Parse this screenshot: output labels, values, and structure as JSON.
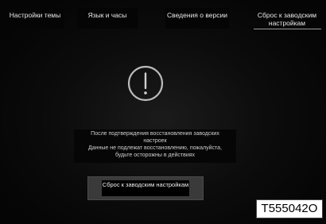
{
  "tabs": [
    {
      "label": "Настройки темы"
    },
    {
      "label": "Язык и часы"
    },
    {
      "label": "Сведения о версии"
    },
    {
      "label": "Сброс к заводским настройкам",
      "selected": true
    }
  ],
  "warning_icon": "exclamation-circle-icon",
  "message": {
    "line1": "После подтверждения восстановления заводских",
    "line2": "настроек",
    "line3": "Данные не подлежат восстановлению, пожалуйста,",
    "line4": "будьте осторожны в действиях"
  },
  "reset_button": {
    "label": "Сброс к заводским настройкам"
  },
  "image_code": "T555042O",
  "colors": {
    "accent_underline": "#9a9a9a",
    "button_bg": "#3a3a3a"
  }
}
